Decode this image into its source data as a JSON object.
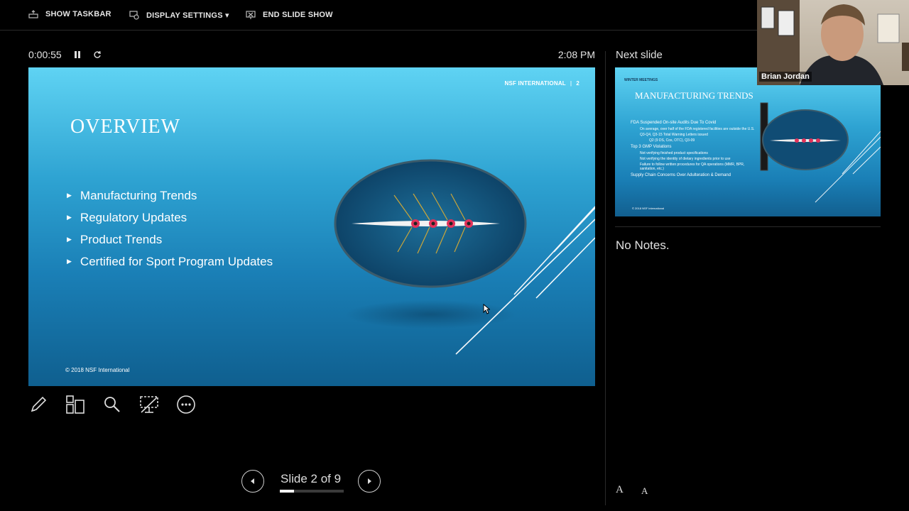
{
  "topbar": {
    "show_taskbar": "SHOW TASKBAR",
    "display_settings": "DISPLAY SETTINGS ▾",
    "end_slide_show": "END SLIDE SHOW"
  },
  "presenter": {
    "elapsed_time": "0:00:55",
    "clock": "2:08 PM"
  },
  "slide": {
    "header_org": "NSF INTERNATIONAL",
    "header_sep": "|",
    "header_page": "2",
    "title": "OVERVIEW",
    "bullets": [
      "Manufacturing Trends",
      "Regulatory Updates",
      "Product Trends",
      "Certified for Sport Program Updates"
    ],
    "footer": "© 2018 NSF International"
  },
  "tools": {
    "icons": [
      "pen-icon",
      "slides-grid-icon",
      "zoom-icon",
      "screen-icon",
      "more-icon"
    ]
  },
  "navigation": {
    "counter": "Slide 2 of 9",
    "current_slide": 2,
    "total_slides": 9,
    "progress_fraction": 0.222
  },
  "next_slide": {
    "label": "Next slide",
    "tag": "WINTER MEETINGS",
    "title": "MANUFACTURING TRENDS",
    "lines": [
      {
        "level": 1,
        "text": "FDA Suspended On-site Audits Due To Covid"
      },
      {
        "level": 2,
        "text": "On average, over half of the FDA registered facilities are outside the U.S."
      },
      {
        "level": 2,
        "text": "Q3-Q4, Q3-15 Total Warning Letters issued"
      },
      {
        "level": 3,
        "text": "Q2 (9 DS, Cos, OTC), Q3-09"
      },
      {
        "level": 1,
        "text": "Top 3 GMP Violations"
      },
      {
        "level": 2,
        "text": "Not verifying finished product specifications"
      },
      {
        "level": 2,
        "text": "Not verifying the identity of dietary ingredients prior to use"
      },
      {
        "level": 2,
        "text": "Failure to follow written procedures for QA operations (MMR, BPR, sanitation, etc.)"
      },
      {
        "level": 1,
        "text": "Supply Chain Concerns Over Adulteration & Demand"
      }
    ],
    "footer": "© 2018 NSF International"
  },
  "notes": {
    "text": "No Notes.",
    "font_increase": "A",
    "font_decrease": "A"
  },
  "video": {
    "participant_name": "Brian Jordan"
  },
  "colors": {
    "background": "#000000",
    "slide_top": "#5fd3f3",
    "slide_bottom": "#0f5f8f",
    "boat_accent": "#e2325a"
  }
}
